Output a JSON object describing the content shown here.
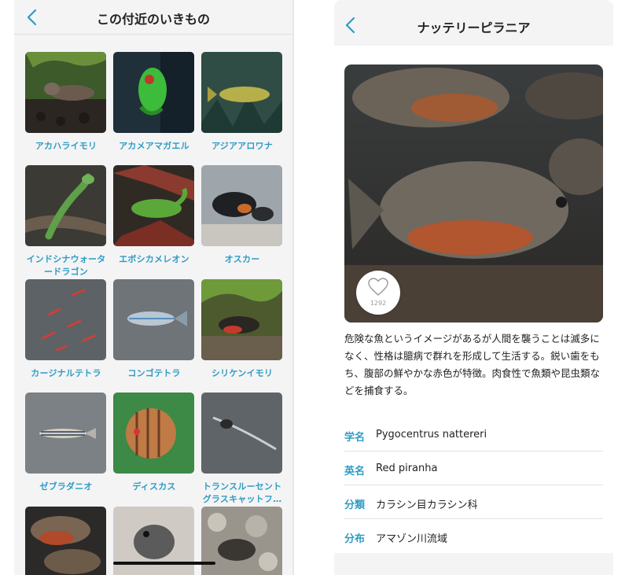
{
  "grid_screen": {
    "title": "この付近のいきもの",
    "icons": {
      "back": "chevron-left-icon"
    },
    "items": [
      {
        "label": "アカハライモリ"
      },
      {
        "label": "アカメアマガエル"
      },
      {
        "label": "アジアアロワナ"
      },
      {
        "label": "インドシナウォータードラゴン"
      },
      {
        "label": "エボシカメレオン"
      },
      {
        "label": "オスカー"
      },
      {
        "label": "カージナルテトラ"
      },
      {
        "label": "コンゴテトラ"
      },
      {
        "label": "シリケンイモリ"
      },
      {
        "label": "ゼブラダニオ"
      },
      {
        "label": "ディスカス"
      },
      {
        "label": "トランスルーセントグラスキャットフ…"
      },
      {
        "label": ""
      },
      {
        "label": ""
      },
      {
        "label": ""
      }
    ]
  },
  "detail_screen": {
    "title": "ナッテリーピラニア",
    "icons": {
      "back": "chevron-left-icon",
      "like": "heart-icon"
    },
    "like_count": "1292",
    "description": "危険な魚というイメージがあるが人間を襲うことは滅多になく、性格は臆病で群れを形成して生活する。鋭い歯をもち、腹部の鮮やかな赤色が特徴。肉食性で魚類や昆虫類などを捕食する。",
    "info": [
      {
        "key": "学名",
        "value": "Pygocentrus nattereri"
      },
      {
        "key": "英名",
        "value": "Red piranha"
      },
      {
        "key": "分類",
        "value": "カラシン目カラシン科"
      },
      {
        "key": "分布",
        "value": "アマゾン川流域"
      }
    ]
  },
  "colors": {
    "accent": "#2e9cc4",
    "background": "#f4f4f5",
    "card": "#ffffff",
    "text": "#222222"
  }
}
